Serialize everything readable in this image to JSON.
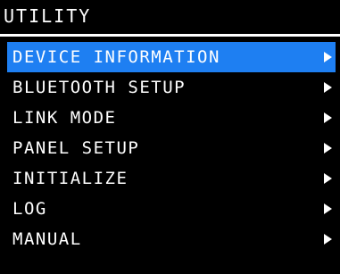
{
  "screen": {
    "title": "UTILITY"
  },
  "colors": {
    "background": "#000000",
    "text": "#ffffff",
    "selection": "#1e7ff2"
  },
  "menu": {
    "selected_index": 0,
    "items": [
      {
        "label": "DEVICE INFORMATION",
        "icon": "chevron-right-icon"
      },
      {
        "label": "BLUETOOTH SETUP",
        "icon": "chevron-right-icon"
      },
      {
        "label": "LINK MODE",
        "icon": "chevron-right-icon"
      },
      {
        "label": "PANEL SETUP",
        "icon": "chevron-right-icon"
      },
      {
        "label": "INITIALIZE",
        "icon": "chevron-right-icon"
      },
      {
        "label": "LOG",
        "icon": "chevron-right-icon"
      },
      {
        "label": "MANUAL",
        "icon": "chevron-right-icon"
      }
    ]
  }
}
